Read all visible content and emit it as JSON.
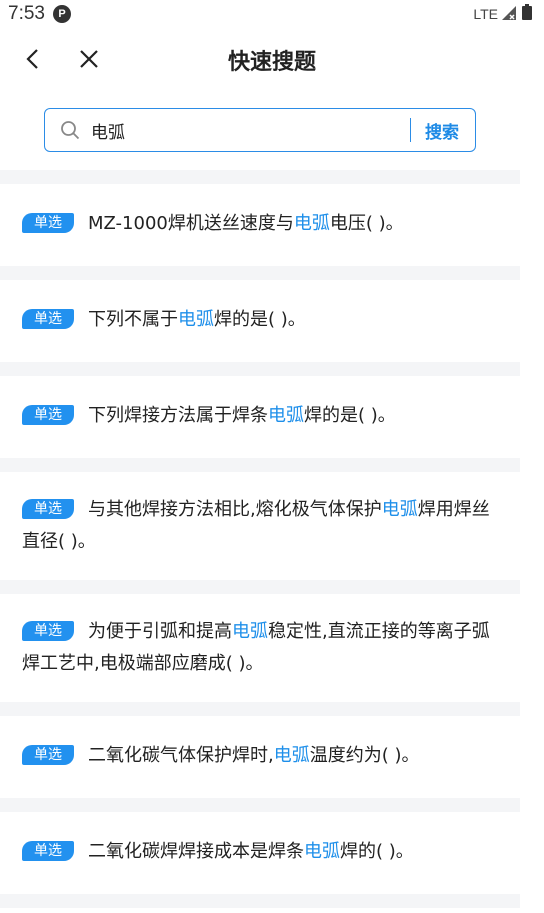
{
  "status_bar": {
    "time": "7:53",
    "network": "LTE"
  },
  "nav": {
    "title": "快速搜题"
  },
  "search": {
    "value": "电弧",
    "button_label": "搜索"
  },
  "questions": [
    {
      "badge": "单选",
      "before": "MZ-1000焊机送丝速度与",
      "keyword": "电弧",
      "after": "电压( )。"
    },
    {
      "badge": "单选",
      "before": "下列不属于",
      "keyword": "电弧",
      "after": "焊的是( )。"
    },
    {
      "badge": "单选",
      "before": "下列焊接方法属于焊条",
      "keyword": "电弧",
      "after": "焊的是( )。"
    },
    {
      "badge": "单选",
      "before": "与其他焊接方法相比,熔化极气体保护",
      "keyword": "电弧",
      "after": "焊用焊丝直径( )。"
    },
    {
      "badge": "单选",
      "before": "为便于引弧和提高",
      "keyword": "电弧",
      "after": "稳定性,直流正接的等离子弧焊工艺中,电极端部应磨成( )。"
    },
    {
      "badge": "单选",
      "before": "二氧化碳气体保护焊时,",
      "keyword": "电弧",
      "after": "温度约为( )。"
    },
    {
      "badge": "单选",
      "before": "二氧化碳焊焊接成本是焊条",
      "keyword": "电弧",
      "after": "焊的( )。"
    }
  ],
  "colors": {
    "accent": "#2291ef",
    "keyword": "#1e8fea",
    "divider": "#f4f5f7"
  }
}
